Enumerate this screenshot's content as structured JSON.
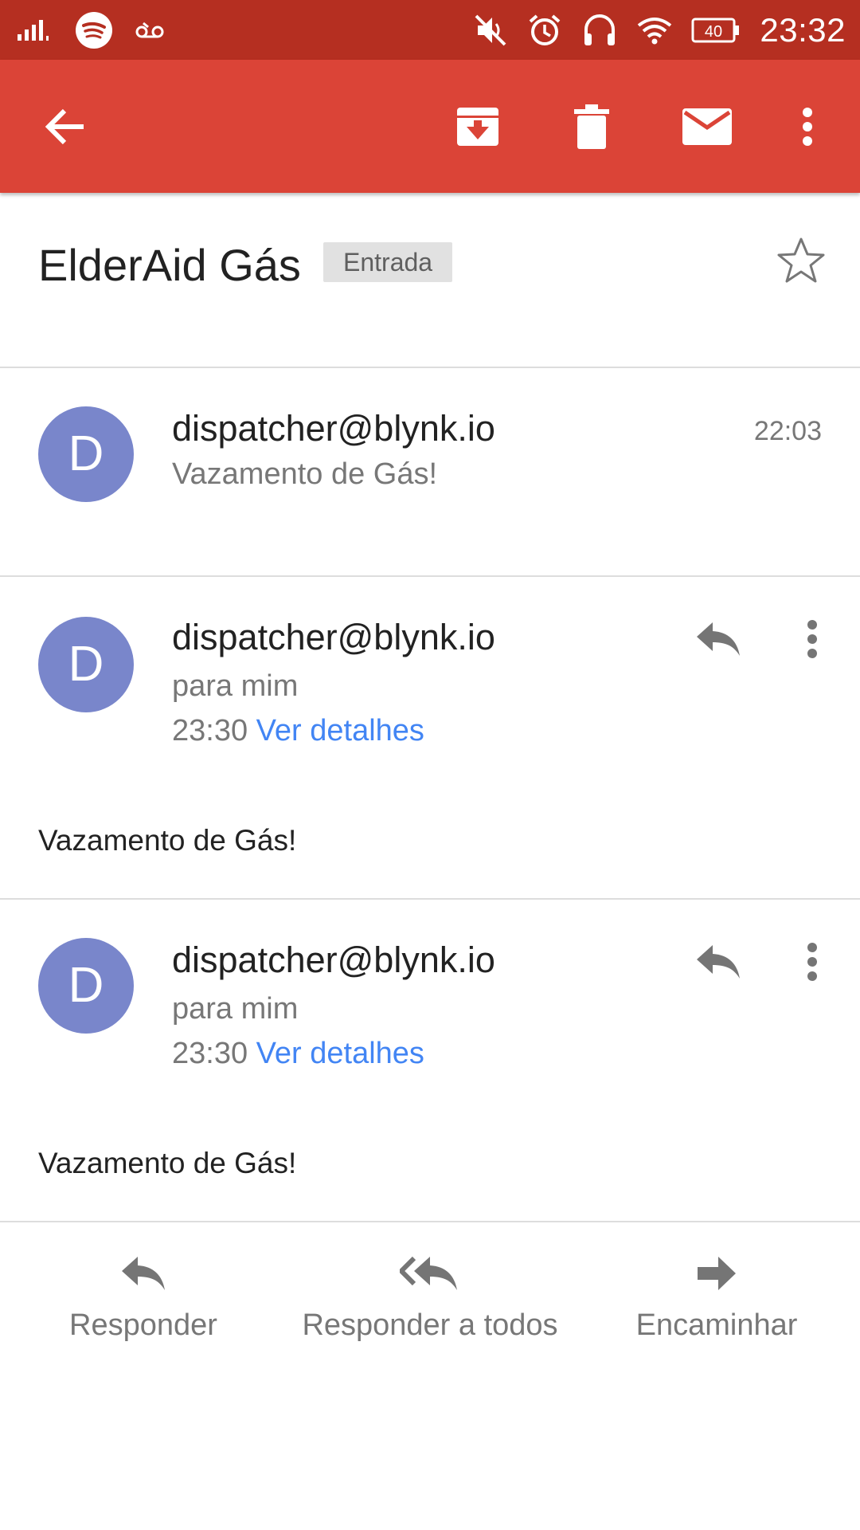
{
  "status_bar": {
    "time": "23:32",
    "battery_level": "40",
    "icons": [
      "signal-icon",
      "spotify-icon",
      "voicemail-icon",
      "mute-icon",
      "alarm-icon",
      "headphones-icon",
      "wifi-icon",
      "battery-icon"
    ]
  },
  "toolbar": {
    "back_icon": "arrow-back-icon",
    "actions": [
      "archive-icon",
      "delete-icon",
      "mark-unread-icon",
      "more-vert-icon"
    ]
  },
  "thread": {
    "subject": "ElderAid Gás",
    "label": "Entrada",
    "starred": false
  },
  "collapsed_message": {
    "avatar_letter": "D",
    "sender": "dispatcher@blynk.io",
    "snippet": "Vazamento de Gás!",
    "time": "22:03"
  },
  "messages": [
    {
      "avatar_letter": "D",
      "sender": "dispatcher@blynk.io",
      "recipient": "para mim",
      "time": "23:30",
      "details_link": "Ver detalhes",
      "body": "Vazamento de Gás!"
    },
    {
      "avatar_letter": "D",
      "sender": "dispatcher@blynk.io",
      "recipient": "para mim",
      "time": "23:30",
      "details_link": "Ver detalhes",
      "body": "Vazamento de Gás!"
    }
  ],
  "bottom_actions": {
    "reply": "Responder",
    "reply_all": "Responder a todos",
    "forward": "Encaminhar"
  },
  "colors": {
    "status_bar": "#b52f21",
    "toolbar": "#db4437",
    "avatar": "#7986cb",
    "link": "#4285f4"
  }
}
